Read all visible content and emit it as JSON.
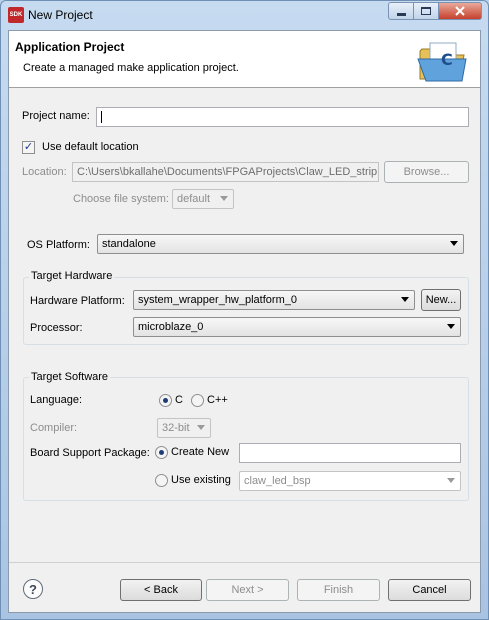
{
  "window": {
    "title": "New Project",
    "app_icon_text": "SDK",
    "minimize_icon": "minimize-icon",
    "maximize_icon": "maximize-icon",
    "close_icon": "close-icon"
  },
  "header": {
    "title": "Application Project",
    "description": "Create a managed make application project.",
    "icon": "c-folder-icon",
    "icon_letter": "C"
  },
  "project": {
    "name_label": "Project name:",
    "name_value": "",
    "use_default_label": "Use default location",
    "use_default_checked": true,
    "location_label": "Location:",
    "location_value": "C:\\Users\\bkallahe\\Documents\\FPGAProjects\\Claw_LED_strip",
    "browse_label": "Browse...",
    "filesystem_label": "Choose file system:",
    "filesystem_value": "default"
  },
  "os": {
    "label": "OS Platform:",
    "value": "standalone"
  },
  "hardware": {
    "group_title": "Target Hardware",
    "platform_label": "Hardware Platform:",
    "platform_value": "system_wrapper_hw_platform_0",
    "new_label": "New...",
    "processor_label": "Processor:",
    "processor_value": "microblaze_0"
  },
  "software": {
    "group_title": "Target Software",
    "language_label": "Language:",
    "lang_c": "C",
    "lang_cpp": "C++",
    "selected_language": "C",
    "compiler_label": "Compiler:",
    "compiler_value": "32-bit",
    "bsp_label": "Board Support Package:",
    "create_new_label": "Create New",
    "create_new_value": "",
    "use_existing_label": "Use existing",
    "existing_value": "claw_led_bsp",
    "selected_bsp": "Create New"
  },
  "footer": {
    "help_icon": "help-icon",
    "help_glyph": "?",
    "back_label": "< Back",
    "next_label": "Next >",
    "finish_label": "Finish",
    "cancel_label": "Cancel"
  }
}
